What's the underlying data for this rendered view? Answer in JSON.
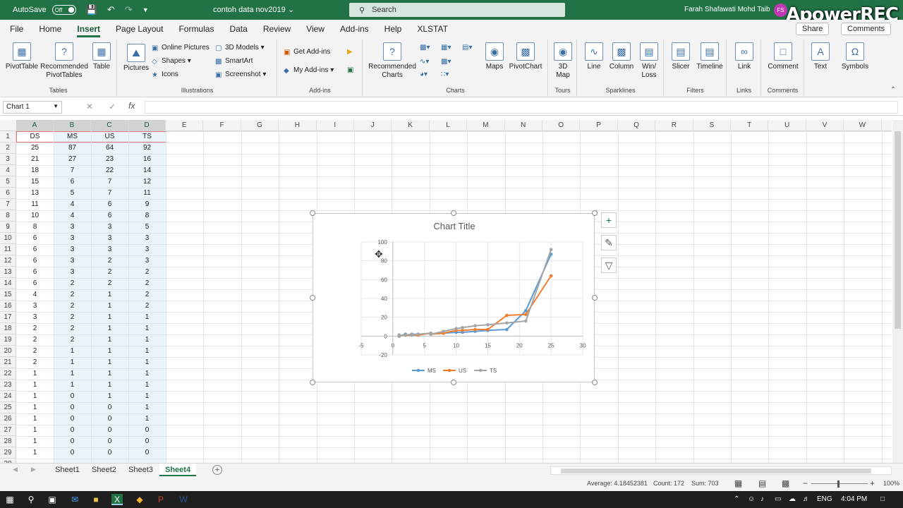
{
  "titlebar": {
    "autosave_label": "AutoSave",
    "autosave_state": "Off",
    "doc_title": "contoh data nov2019",
    "search_placeholder": "Search",
    "user_name": "Farah Shafawati Mohd Taib",
    "user_initials": "FS",
    "watermark": "ApowerREC"
  },
  "menu": {
    "tabs": [
      "File",
      "Home",
      "Insert",
      "Page Layout",
      "Formulas",
      "Data",
      "Review",
      "View",
      "Add-ins",
      "Help",
      "XLSTAT"
    ],
    "active": "Insert",
    "share": "Share",
    "comments": "Comments"
  },
  "ribbon": {
    "tables": {
      "label": "Tables",
      "pivot": "PivotTable",
      "recommended_pivot": "Recommended PivotTables",
      "table": "Table"
    },
    "illustrations": {
      "label": "Illustrations",
      "pictures": "Pictures",
      "online_pictures": "Online Pictures",
      "shapes": "Shapes",
      "icons": "Icons",
      "models": "3D Models",
      "smartart": "SmartArt",
      "screenshot": "Screenshot"
    },
    "addins": {
      "label": "Add-ins",
      "get": "Get Add-ins",
      "my": "My Add-ins"
    },
    "charts": {
      "label": "Charts",
      "recommended": "Recommended Charts",
      "maps": "Maps",
      "pivotchart": "PivotChart"
    },
    "tours": {
      "label": "Tours",
      "map3d": "3D Map"
    },
    "sparklines": {
      "label": "Sparklines",
      "line": "Line",
      "column": "Column",
      "winloss": "Win/ Loss"
    },
    "filters": {
      "label": "Filters",
      "slicer": "Slicer",
      "timeline": "Timeline"
    },
    "links": {
      "label": "Links",
      "link": "Link"
    },
    "comments": {
      "label": "Comments",
      "comment": "Comment"
    },
    "text": {
      "label": "",
      "text": "Text"
    },
    "symbols": {
      "label": "",
      "symbols": "Symbols"
    }
  },
  "formula_bar": {
    "name_box": "Chart 1",
    "fx": "fx",
    "value": ""
  },
  "columns": [
    "A",
    "B",
    "C",
    "D",
    "E",
    "F",
    "G",
    "H",
    "I",
    "J",
    "K",
    "L",
    "M",
    "N",
    "O",
    "P",
    "Q",
    "R",
    "S",
    "T",
    "U",
    "V",
    "W"
  ],
  "sheet": {
    "headers": [
      "DS",
      "MS",
      "US",
      "TS"
    ],
    "rows": [
      [
        25,
        87,
        64,
        92
      ],
      [
        21,
        27,
        23,
        16
      ],
      [
        18,
        7,
        22,
        14
      ],
      [
        15,
        6,
        7,
        12
      ],
      [
        13,
        5,
        7,
        11
      ],
      [
        11,
        4,
        6,
        9
      ],
      [
        10,
        4,
        6,
        8
      ],
      [
        8,
        3,
        3,
        5
      ],
      [
        6,
        3,
        3,
        3
      ],
      [
        6,
        3,
        3,
        3
      ],
      [
        6,
        3,
        2,
        3
      ],
      [
        6,
        3,
        2,
        2
      ],
      [
        6,
        2,
        2,
        2
      ],
      [
        4,
        2,
        1,
        2
      ],
      [
        3,
        2,
        1,
        2
      ],
      [
        3,
        2,
        1,
        1
      ],
      [
        2,
        2,
        1,
        1
      ],
      [
        2,
        2,
        1,
        1
      ],
      [
        2,
        1,
        1,
        1
      ],
      [
        2,
        1,
        1,
        1
      ],
      [
        1,
        1,
        1,
        1
      ],
      [
        1,
        1,
        1,
        1
      ],
      [
        1,
        0,
        1,
        1
      ],
      [
        1,
        0,
        0,
        1
      ],
      [
        1,
        0,
        0,
        1
      ],
      [
        1,
        0,
        0,
        0
      ],
      [
        1,
        0,
        0,
        0
      ],
      [
        1,
        0,
        0,
        0
      ]
    ]
  },
  "chart_data": {
    "type": "scatter",
    "title": "Chart Title",
    "xlabel": "",
    "ylabel": "",
    "xlim": [
      -5,
      30
    ],
    "ylim": [
      -20,
      100
    ],
    "xticks": [
      -5,
      0,
      5,
      10,
      15,
      20,
      25,
      30
    ],
    "yticks": [
      -20,
      0,
      20,
      40,
      60,
      80,
      100
    ],
    "grid": true,
    "legend": "bottom",
    "x": [
      25,
      21,
      18,
      15,
      13,
      11,
      10,
      8,
      6,
      6,
      6,
      6,
      6,
      4,
      3,
      3,
      2,
      2,
      2,
      2,
      1,
      1,
      1,
      1,
      1,
      1,
      1,
      1
    ],
    "series": [
      {
        "name": "MS",
        "color": "#5b9bd5",
        "values": [
          87,
          27,
          7,
          6,
          5,
          4,
          4,
          3,
          3,
          3,
          3,
          3,
          2,
          2,
          2,
          2,
          2,
          2,
          1,
          1,
          1,
          1,
          0,
          0,
          0,
          0,
          0,
          0
        ]
      },
      {
        "name": "US",
        "color": "#ed7d31",
        "values": [
          64,
          23,
          22,
          7,
          7,
          6,
          6,
          3,
          3,
          3,
          2,
          2,
          2,
          1,
          1,
          1,
          1,
          1,
          1,
          1,
          1,
          1,
          1,
          0,
          0,
          0,
          0,
          0
        ]
      },
      {
        "name": "TS",
        "color": "#a5a5a5",
        "values": [
          92,
          16,
          14,
          12,
          11,
          9,
          8,
          5,
          3,
          3,
          3,
          2,
          2,
          2,
          2,
          1,
          1,
          1,
          1,
          1,
          1,
          1,
          1,
          1,
          1,
          0,
          0,
          0
        ]
      }
    ]
  },
  "sheets": {
    "tabs": [
      "Sheet1",
      "Sheet2",
      "Sheet3",
      "Sheet4"
    ],
    "active": "Sheet4"
  },
  "status": {
    "average": "Average: 4.18452381",
    "count": "Count: 172",
    "sum": "Sum: 703",
    "zoom": "100%"
  },
  "taskbar": {
    "lang": "ENG",
    "time": "4:04 PM"
  }
}
